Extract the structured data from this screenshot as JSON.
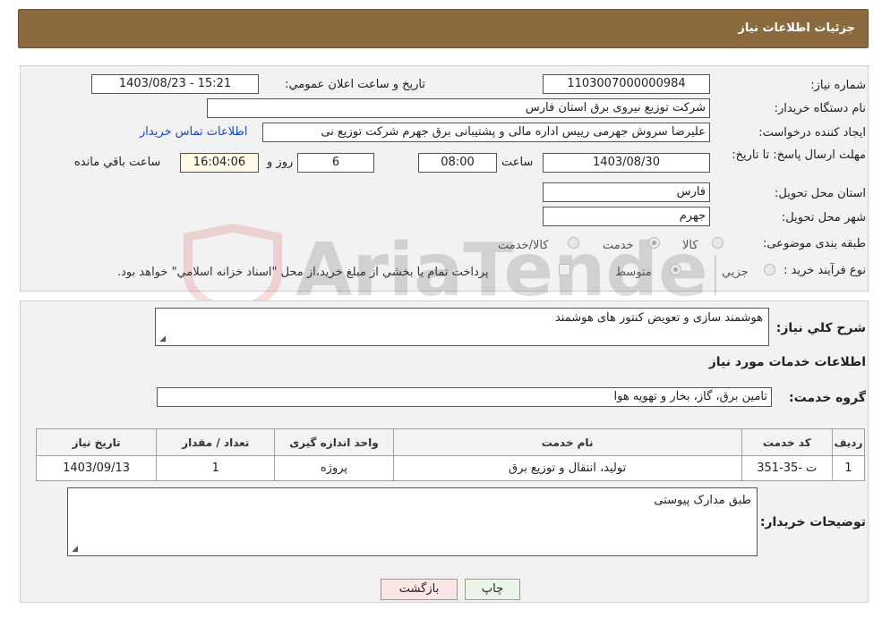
{
  "header": {
    "title": "جزئیات اطلاعات نیاز"
  },
  "fields": {
    "need_number_label": "شماره نیاز:",
    "need_number": "1103007000000984",
    "announce_label": "تاریخ و ساعت اعلان عمومي:",
    "announce_value": "1403/08/23 - 15:21",
    "buyer_org_label": "نام دستگاه خريدار:",
    "buyer_org": "شرکت توزیع نیروی برق استان فارس",
    "requester_label": "ايجاد کننده درخواست:",
    "requester": "علیرضا  سروش جهرمی رییس اداره مالی و پشتیبانی برق جهرم شرکت توزیع نی",
    "contact_link": "اطلاعات تماس خريدار",
    "deadline_label": "مهلت ارسال پاسخ: تا تاريخ:",
    "deadline_date": "1403/08/30",
    "time_label": "ساعت",
    "deadline_time": "08:00",
    "days_value": "6",
    "days_label": "روز و",
    "remaining_time": "16:04:06",
    "remaining_label": "ساعت باقي مانده",
    "province_label": "استان محل تحويل:",
    "province": "فارس",
    "city_label": "شهر محل تحويل:",
    "city": "جهرم",
    "category_label": "طبقه بندی موضوعی:",
    "category_options": [
      "کالا",
      "خدمت",
      "کالا/خدمت"
    ],
    "process_label": "نوع فرآيند خريد :",
    "process_options": [
      "جزيي",
      "متوسط"
    ],
    "payment_note": "پرداخت تمام يا بخشي از مبلغ خريد،از محل \"اسناد خزانه اسلامي\" خواهد بود."
  },
  "description": {
    "label": "شرح کلي نياز:",
    "value": "هوشمند سازی و تعویض کنتور های هوشمند"
  },
  "services": {
    "section_title": "اطلاعات خدمات مورد نياز",
    "group_label": "گروه خدمت:",
    "group_value": "تامين برق، گاز، بخار و تهويه هوا",
    "columns": [
      "رديف",
      "کد خدمت",
      "نام خدمت",
      "واحد اندازه گيری",
      "تعداد / مقدار",
      "تاريخ نياز"
    ],
    "rows": [
      [
        "1",
        "ت -35-351",
        "توليد، انتقال و توزيع برق",
        "پروژه",
        "1",
        "1403/09/13"
      ]
    ]
  },
  "buyer_notes": {
    "label": "توضيحات خريدار:",
    "value": "طبق مدارک پیوستی"
  },
  "buttons": {
    "print": "چاپ",
    "back": "بازگشت"
  },
  "watermark": {
    "text": "AriaTender.neT"
  }
}
